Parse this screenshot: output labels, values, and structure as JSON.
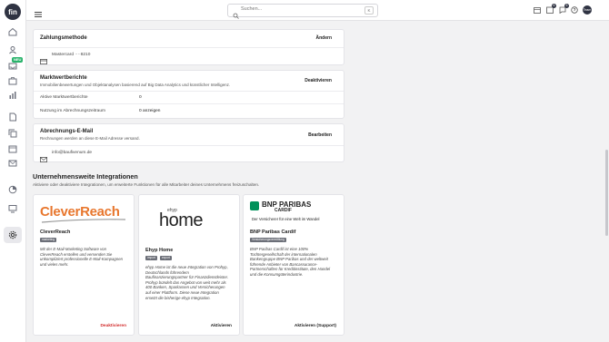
{
  "app": {
    "logo_text": "fin",
    "neu_badge": "NEU"
  },
  "topbar": {
    "search_placeholder": "Suchen...",
    "search_shortcut": "K",
    "badge_notifications": "6",
    "badge_messages": "5",
    "avatar_text": "Team"
  },
  "payment": {
    "title": "Zahlungsmethode",
    "action": "Ändern",
    "card_label": "Mastercard ····8210"
  },
  "market": {
    "title": "Marktwertberichte",
    "description": "Immobilienbewertungen und Objektanalysen basierend auf Big Data Analytics und künstlicher Intelligenz.",
    "action": "Deaktivieren",
    "rows": [
      {
        "label": "Aktive Marktwertberichte",
        "value": "0"
      },
      {
        "label": "Nutzung im Abrechnungszeitraum",
        "value": "0 anzeigen"
      }
    ]
  },
  "billing_email": {
    "title": "Abrechnungs-E-Mail",
    "description": "Rechnungen werden an diese E-Mail Adresse versand.",
    "action": "Bearbeiten",
    "email": "info@baufivenum.de"
  },
  "integrations": {
    "title": "Unternehmensweite Integrationen",
    "description": "Aktiviere oder deaktiviere Integrationen, um erweiterte Funktionen für alle Mitarbeiter deines Unternehmens freizuschalten.",
    "items": [
      {
        "logo_text": "CleverReach",
        "name": "CleverReach",
        "tags": [
          "marketing"
        ],
        "description": "Mit der E-Mail-Marketing Software von CleverReach erstellen und versenden Sie unkompliziert professionelle E-Mail-Kampagnen und vieles mehr.",
        "action": "Deaktivieren",
        "action_color": "#d32f2f"
      },
      {
        "logo_small": "ehyp",
        "logo_text": "home",
        "name": "Ehyp Home",
        "tags": [
          "import",
          "export"
        ],
        "description": "ehyp Home ist die neue Integration von Prohyp, Deutschlands führendem Baufinanzierungspartner für Finanzdienstleister. Prohyp bündelt das Angebot von weit mehr als 400 Banken, Sparkassen und Versicherungen auf einer Plattform. Diese neue Integration ersetzt die bisherige ehyp Integration.",
        "action": "Aktivieren",
        "action_color": "#222222"
      },
      {
        "logo_text": "BNP PARIBAS",
        "logo_sub": "CARDIF",
        "logo_tagline": "Der Versicherer für eine Welt im Wandel",
        "name": "BNP Paribas Cardif",
        "tags": [
          "Versicherungsvermittlung"
        ],
        "description": "BNP Paribas Cardif ist eine 100% Tochtergesellschaft der internationalen Bankengruppe BNP Paribas und der weltweit führende Anbieter von Bancassurance-Partnerschaften für Kreditinstitute, den Handel und die Konsumgüterindustrie.",
        "action": "Aktivieren (Support)",
        "action_color": "#222222"
      }
    ]
  },
  "colors": {
    "cleverreach_orange": "#e8772e",
    "bnp_green": "#00915a",
    "danger": "#d32f2f"
  }
}
